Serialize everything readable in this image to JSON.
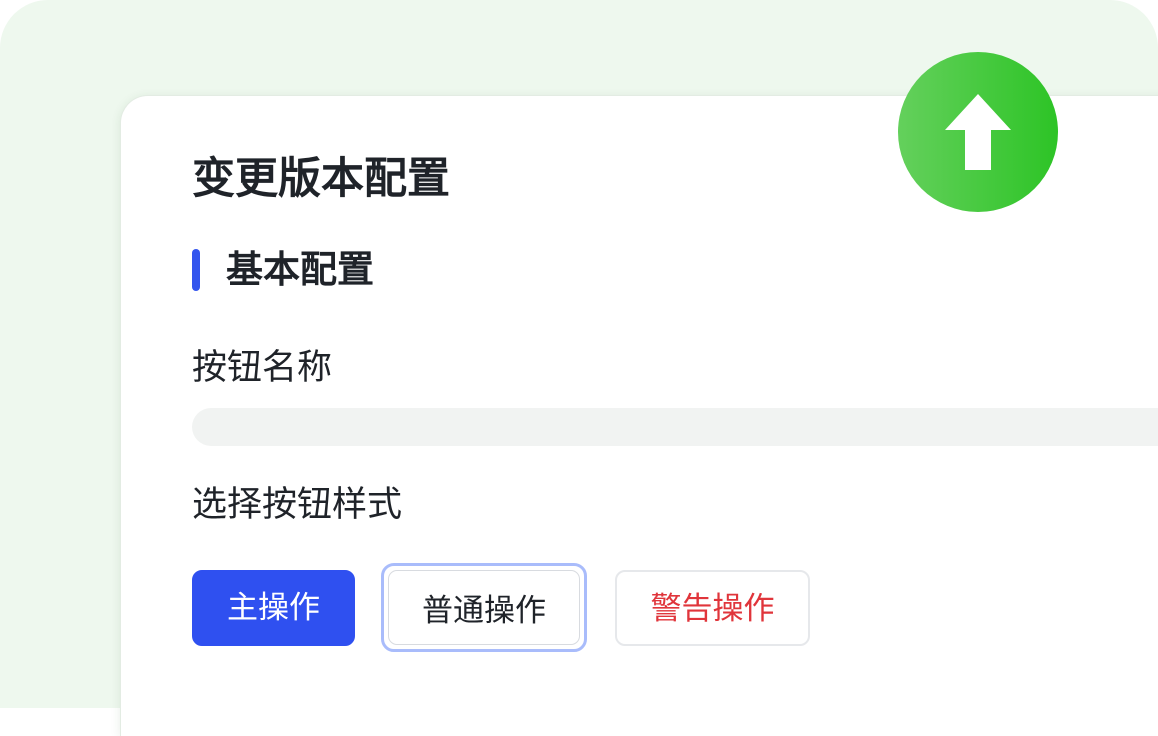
{
  "dialog": {
    "title": "变更版本配置"
  },
  "section": {
    "title": "基本配置"
  },
  "fields": {
    "button_name_label": "按钮名称",
    "button_name_value": "",
    "button_name_placeholder": "",
    "button_style_label": "选择按钮样式"
  },
  "style_options": {
    "primary_label": "主操作",
    "normal_label": "普通操作",
    "warning_label": "警告操作",
    "selected": "普通操作"
  },
  "badge": {
    "icon": "upload-arrow-icon"
  },
  "colors": {
    "accent_blue": "#2f50f0",
    "section_bar": "#3355ee",
    "badge_green_start": "#64d05c",
    "badge_green_end": "#2dc426",
    "warning_red": "#e0353b",
    "selected_ring": "#a9bcfb",
    "backdrop_green": "#eef8ee"
  }
}
